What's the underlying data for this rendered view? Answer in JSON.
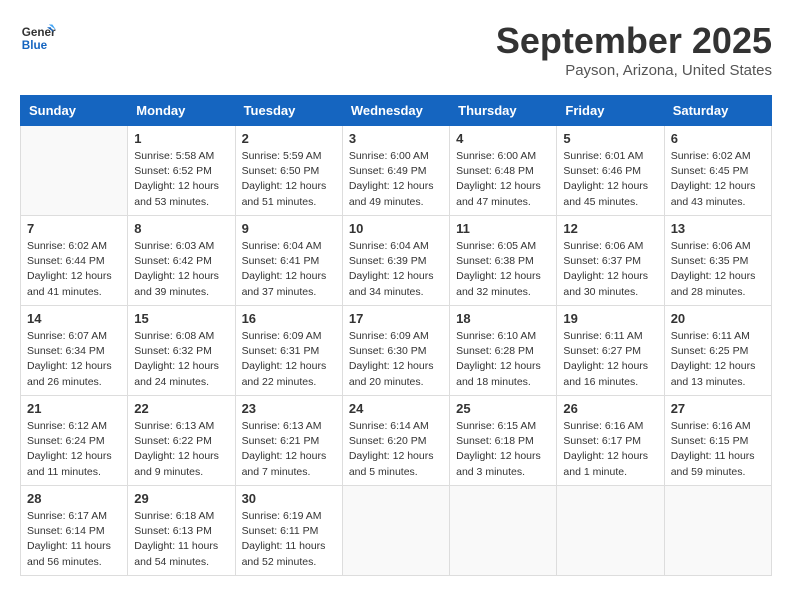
{
  "logo": {
    "line1": "General",
    "line2": "Blue"
  },
  "title": "September 2025",
  "location": "Payson, Arizona, United States",
  "weekdays": [
    "Sunday",
    "Monday",
    "Tuesday",
    "Wednesday",
    "Thursday",
    "Friday",
    "Saturday"
  ],
  "weeks": [
    [
      {
        "day": "",
        "info": ""
      },
      {
        "day": "1",
        "info": "Sunrise: 5:58 AM\nSunset: 6:52 PM\nDaylight: 12 hours\nand 53 minutes."
      },
      {
        "day": "2",
        "info": "Sunrise: 5:59 AM\nSunset: 6:50 PM\nDaylight: 12 hours\nand 51 minutes."
      },
      {
        "day": "3",
        "info": "Sunrise: 6:00 AM\nSunset: 6:49 PM\nDaylight: 12 hours\nand 49 minutes."
      },
      {
        "day": "4",
        "info": "Sunrise: 6:00 AM\nSunset: 6:48 PM\nDaylight: 12 hours\nand 47 minutes."
      },
      {
        "day": "5",
        "info": "Sunrise: 6:01 AM\nSunset: 6:46 PM\nDaylight: 12 hours\nand 45 minutes."
      },
      {
        "day": "6",
        "info": "Sunrise: 6:02 AM\nSunset: 6:45 PM\nDaylight: 12 hours\nand 43 minutes."
      }
    ],
    [
      {
        "day": "7",
        "info": "Sunrise: 6:02 AM\nSunset: 6:44 PM\nDaylight: 12 hours\nand 41 minutes."
      },
      {
        "day": "8",
        "info": "Sunrise: 6:03 AM\nSunset: 6:42 PM\nDaylight: 12 hours\nand 39 minutes."
      },
      {
        "day": "9",
        "info": "Sunrise: 6:04 AM\nSunset: 6:41 PM\nDaylight: 12 hours\nand 37 minutes."
      },
      {
        "day": "10",
        "info": "Sunrise: 6:04 AM\nSunset: 6:39 PM\nDaylight: 12 hours\nand 34 minutes."
      },
      {
        "day": "11",
        "info": "Sunrise: 6:05 AM\nSunset: 6:38 PM\nDaylight: 12 hours\nand 32 minutes."
      },
      {
        "day": "12",
        "info": "Sunrise: 6:06 AM\nSunset: 6:37 PM\nDaylight: 12 hours\nand 30 minutes."
      },
      {
        "day": "13",
        "info": "Sunrise: 6:06 AM\nSunset: 6:35 PM\nDaylight: 12 hours\nand 28 minutes."
      }
    ],
    [
      {
        "day": "14",
        "info": "Sunrise: 6:07 AM\nSunset: 6:34 PM\nDaylight: 12 hours\nand 26 minutes."
      },
      {
        "day": "15",
        "info": "Sunrise: 6:08 AM\nSunset: 6:32 PM\nDaylight: 12 hours\nand 24 minutes."
      },
      {
        "day": "16",
        "info": "Sunrise: 6:09 AM\nSunset: 6:31 PM\nDaylight: 12 hours\nand 22 minutes."
      },
      {
        "day": "17",
        "info": "Sunrise: 6:09 AM\nSunset: 6:30 PM\nDaylight: 12 hours\nand 20 minutes."
      },
      {
        "day": "18",
        "info": "Sunrise: 6:10 AM\nSunset: 6:28 PM\nDaylight: 12 hours\nand 18 minutes."
      },
      {
        "day": "19",
        "info": "Sunrise: 6:11 AM\nSunset: 6:27 PM\nDaylight: 12 hours\nand 16 minutes."
      },
      {
        "day": "20",
        "info": "Sunrise: 6:11 AM\nSunset: 6:25 PM\nDaylight: 12 hours\nand 13 minutes."
      }
    ],
    [
      {
        "day": "21",
        "info": "Sunrise: 6:12 AM\nSunset: 6:24 PM\nDaylight: 12 hours\nand 11 minutes."
      },
      {
        "day": "22",
        "info": "Sunrise: 6:13 AM\nSunset: 6:22 PM\nDaylight: 12 hours\nand 9 minutes."
      },
      {
        "day": "23",
        "info": "Sunrise: 6:13 AM\nSunset: 6:21 PM\nDaylight: 12 hours\nand 7 minutes."
      },
      {
        "day": "24",
        "info": "Sunrise: 6:14 AM\nSunset: 6:20 PM\nDaylight: 12 hours\nand 5 minutes."
      },
      {
        "day": "25",
        "info": "Sunrise: 6:15 AM\nSunset: 6:18 PM\nDaylight: 12 hours\nand 3 minutes."
      },
      {
        "day": "26",
        "info": "Sunrise: 6:16 AM\nSunset: 6:17 PM\nDaylight: 12 hours\nand 1 minute."
      },
      {
        "day": "27",
        "info": "Sunrise: 6:16 AM\nSunset: 6:15 PM\nDaylight: 11 hours\nand 59 minutes."
      }
    ],
    [
      {
        "day": "28",
        "info": "Sunrise: 6:17 AM\nSunset: 6:14 PM\nDaylight: 11 hours\nand 56 minutes."
      },
      {
        "day": "29",
        "info": "Sunrise: 6:18 AM\nSunset: 6:13 PM\nDaylight: 11 hours\nand 54 minutes."
      },
      {
        "day": "30",
        "info": "Sunrise: 6:19 AM\nSunset: 6:11 PM\nDaylight: 11 hours\nand 52 minutes."
      },
      {
        "day": "",
        "info": ""
      },
      {
        "day": "",
        "info": ""
      },
      {
        "day": "",
        "info": ""
      },
      {
        "day": "",
        "info": ""
      }
    ]
  ]
}
